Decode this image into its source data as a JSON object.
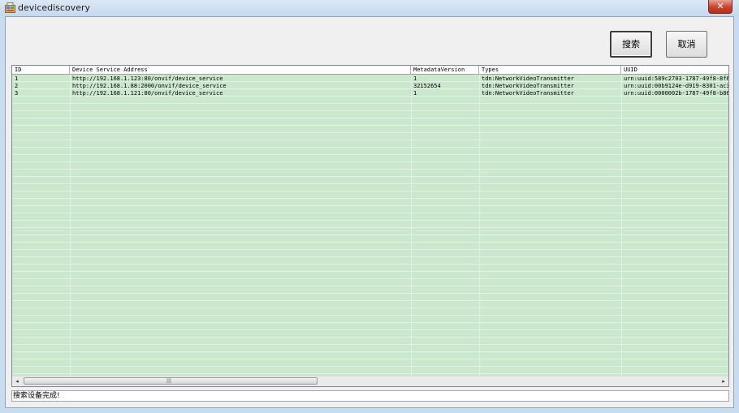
{
  "window": {
    "title": "devicediscovery",
    "close_glyph": "✕",
    "accent": "#c7412b"
  },
  "toolbar": {
    "search_label": "搜索",
    "cancel_label": "取消"
  },
  "table": {
    "columns": [
      "ID",
      "Device Service Address",
      "MetadataVersion",
      "Types",
      "UUID"
    ],
    "rows": [
      [
        "1",
        "http://192.168.1.123:80/onvif/device_service",
        "1",
        "tdn:NetworkVideoTransmitter",
        "urn:uuid:589c2703-1787-49f8-8f6"
      ],
      [
        "2",
        "http://192.168.1.88:2000/onvif/device_service",
        "32152654",
        "tdn:NetworkVideoTransmitter",
        "urn:uuid:00b9124e-d919-8301-ac3"
      ],
      [
        "3",
        "http://192.168.1.121:80/onvif/device_service",
        "1",
        "tdn:NetworkVideoTransmitter",
        "urn:uuid:0000002b-1787-49f8-b86"
      ]
    ],
    "row_color": "#c5e6c9"
  },
  "scrollbar": {
    "left_arrow": "◂",
    "right_arrow": "▸",
    "grip": "|||"
  },
  "status": {
    "text": "搜索设备完成!"
  },
  "icons": {
    "app": "app-icon",
    "close": "close-icon"
  }
}
